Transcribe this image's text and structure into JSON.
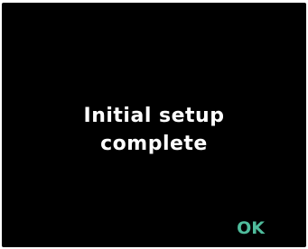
{
  "dialog": {
    "message_line1": "Initial setup",
    "message_line2": "complete",
    "ok_label": "OK"
  },
  "colors": {
    "background": "#000000",
    "text": "#ffffff",
    "accent": "#4fbc9c"
  }
}
